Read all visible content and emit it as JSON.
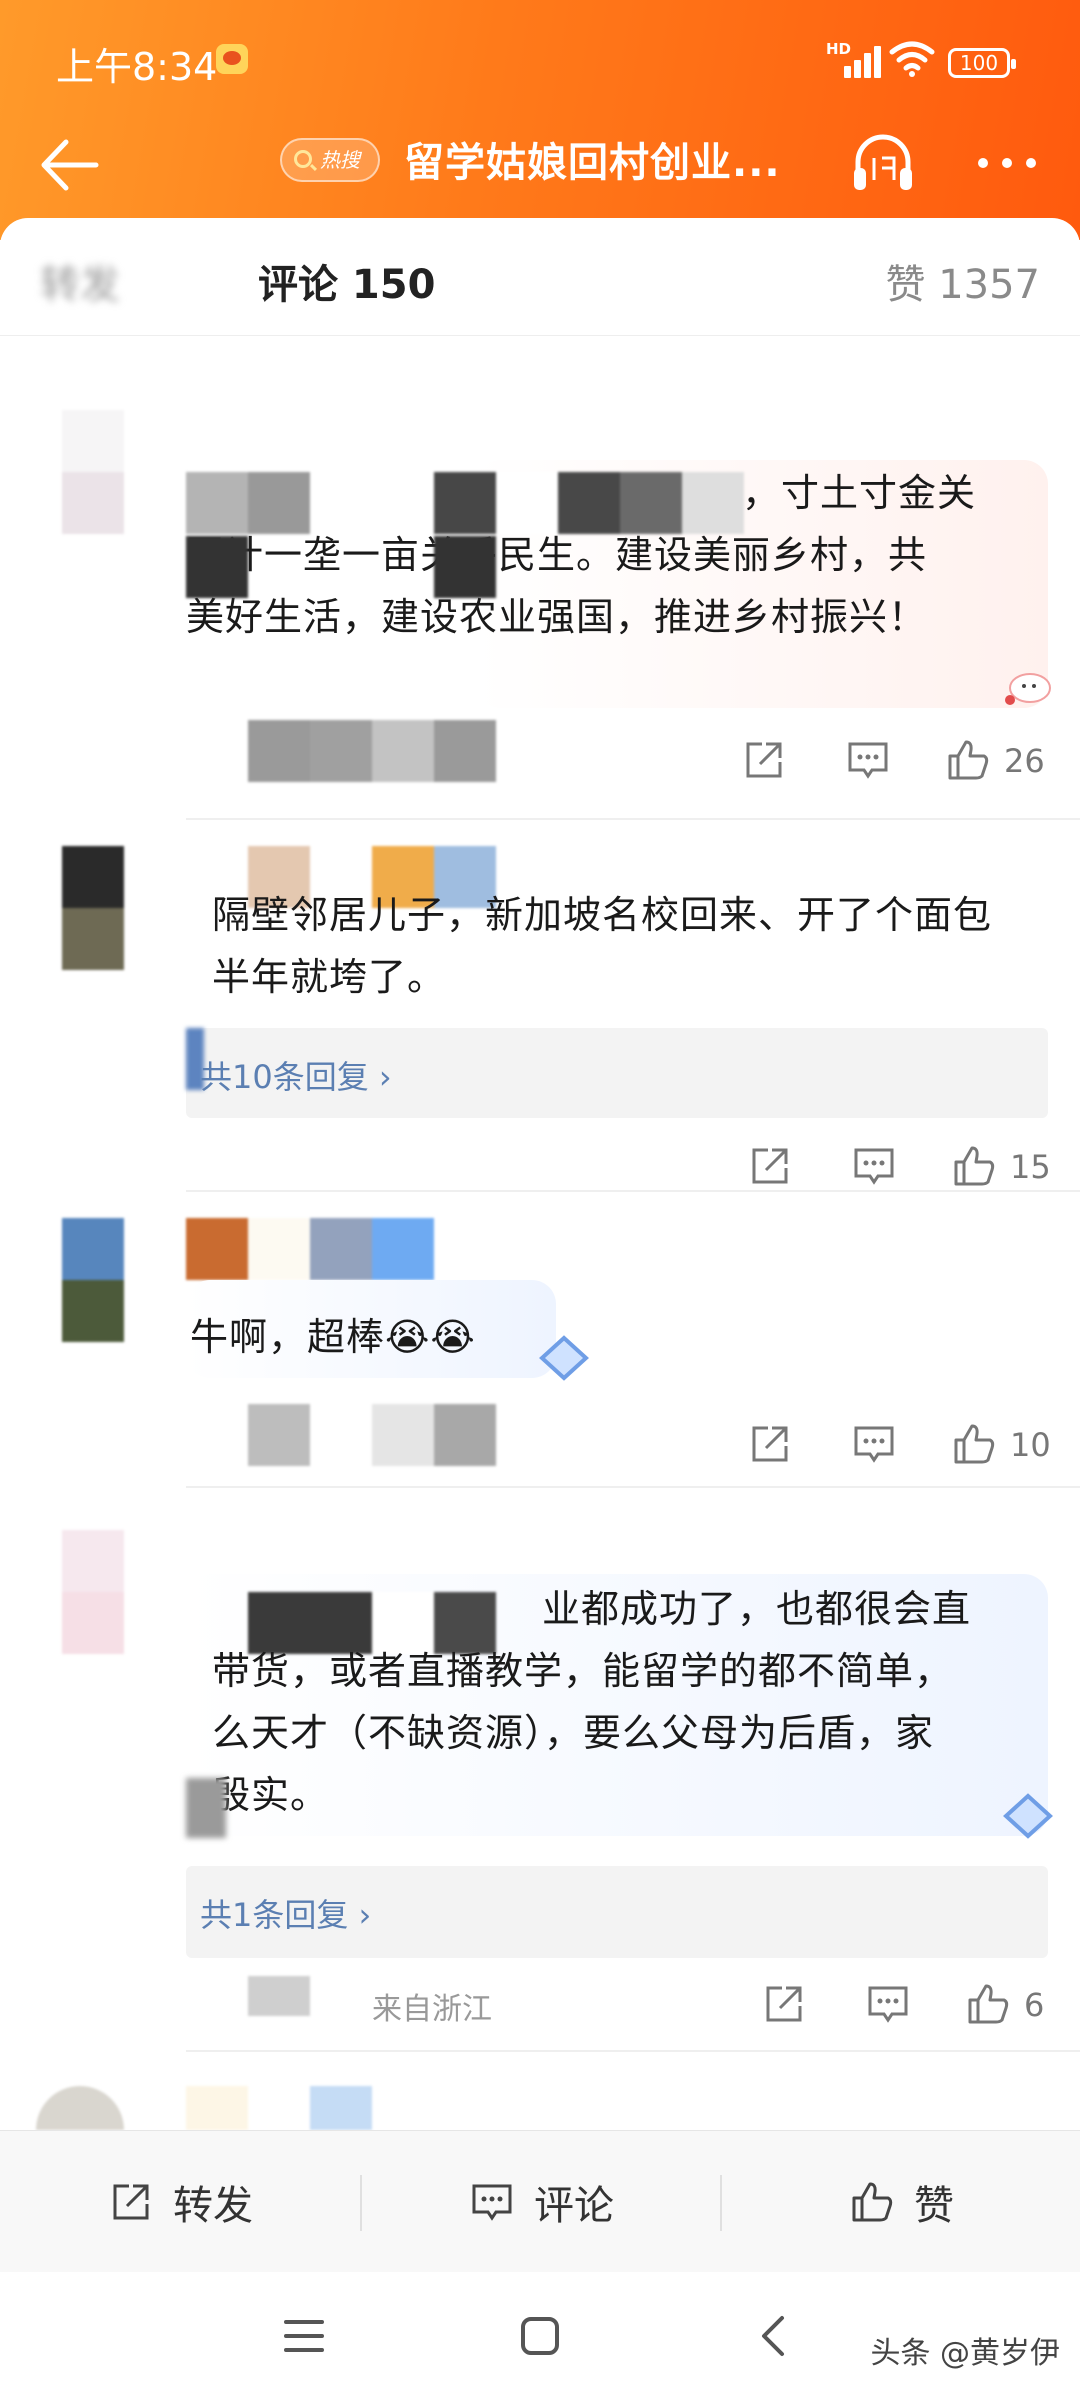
{
  "status_bar": {
    "time": "上午8:34",
    "signal_label": "HD",
    "battery": "100"
  },
  "nav": {
    "hot_tag": "热搜",
    "title": "留学姑娘回村创业..."
  },
  "tabs": {
    "repost": "转发",
    "comment": "评论 150",
    "like": "赞 1357"
  },
  "comments": [
    {
      "lines": [
        "，寸土寸金关",
        "国计一垄一亩关乎民生。建设美丽乡村，共",
        "美好生活，建设农业强国，推进乡村振兴！"
      ],
      "like_count": "26"
    },
    {
      "lines": [
        "隔壁邻居儿子，新加坡名校回来、开了个面包",
        "半年就垮了。"
      ],
      "reply_text": "共10条回复 ›",
      "like_count": "15"
    },
    {
      "lines": [
        "牛啊，超棒😭😭"
      ],
      "like_count": "10"
    },
    {
      "lines": [
        "业都成功了，也都很会直",
        "带货，或者直播教学，能留学的都不简单，",
        "么天才（不缺资源），要么父母为后盾，家",
        "殷实。"
      ],
      "reply_text": "共1条回复 ›",
      "meta": "来自浙江",
      "like_count": "6"
    }
  ],
  "bottom_bar": {
    "repost": "转发",
    "comment": "评论",
    "like": "赞"
  },
  "watermark": "头条 @黄岁伊",
  "colors": {
    "header_start": "#ff9a2a",
    "header_end": "#ff5a0e",
    "link": "#5b7fb2"
  }
}
